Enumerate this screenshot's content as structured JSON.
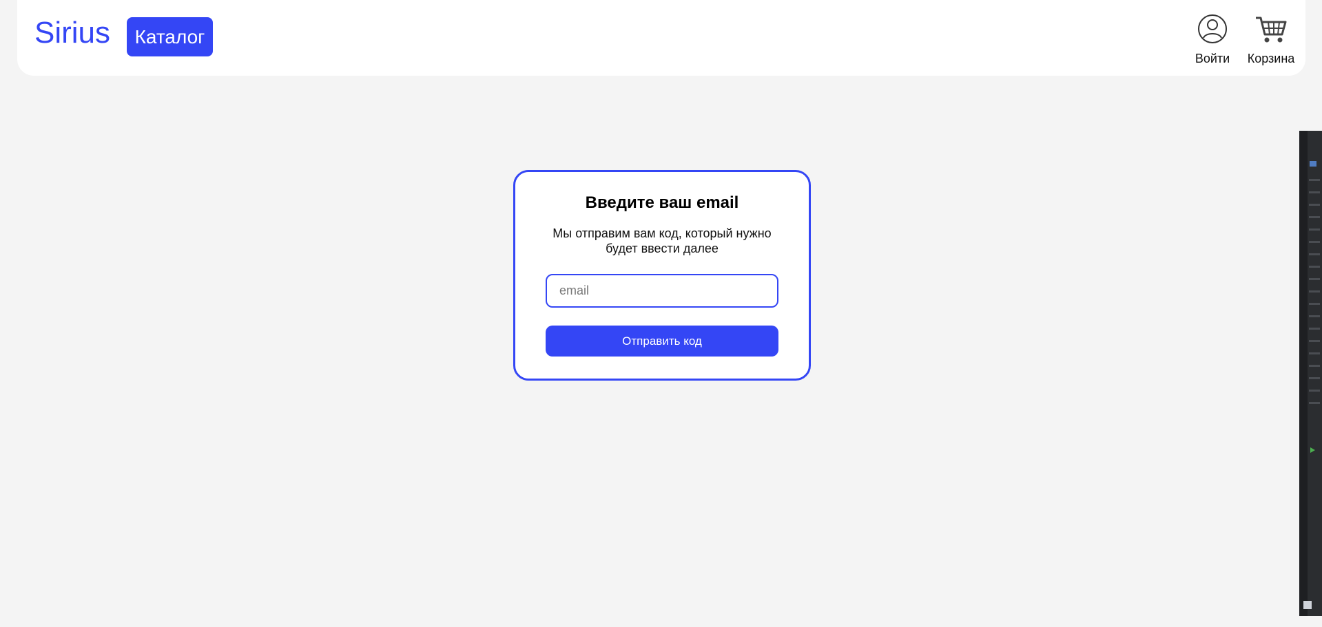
{
  "header": {
    "logo": "Sirius",
    "catalog_label": "Каталог",
    "login_label": "Войти",
    "cart_label": "Корзина",
    "login_icon": "user-circle-icon",
    "cart_icon": "shopping-cart-icon"
  },
  "form": {
    "title": "Введите ваш email",
    "description": "Мы отправим вам код, который нужно будет ввести далее",
    "email_placeholder": "email",
    "email_value": "",
    "submit_label": "Отправить код"
  },
  "colors": {
    "accent": "#3446f5",
    "background": "#f4f4f4",
    "surface": "#ffffff"
  }
}
